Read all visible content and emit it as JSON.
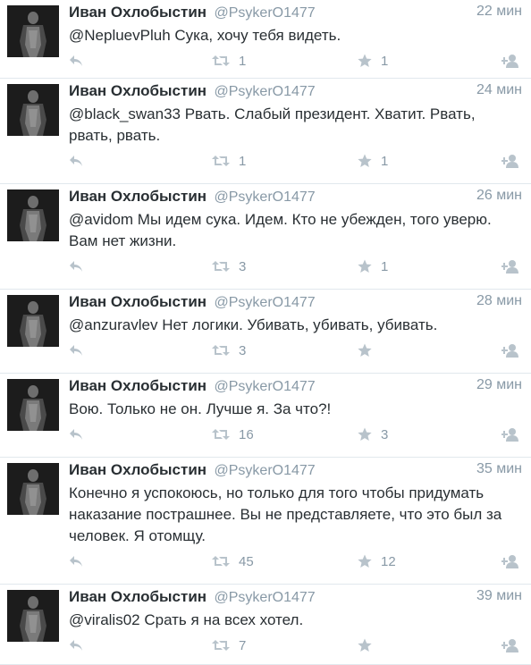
{
  "tweets": [
    {
      "name": "Иван Охлобыстин",
      "handle": "@PsykerO1477",
      "time": "22 мин",
      "text": "@NepluevPluh Сука, хочу тебя видеть.",
      "retweets": "1",
      "favorites": "1"
    },
    {
      "name": "Иван Охлобыстин",
      "handle": "@PsykerO1477",
      "time": "24 мин",
      "text": "@black_swan33 Рвать. Слабый президент. Хватит. Рвать, рвать, рвать.",
      "retweets": "1",
      "favorites": "1"
    },
    {
      "name": "Иван Охлобыстин",
      "handle": "@PsykerO1477",
      "time": "26 мин",
      "text": "@avidom Мы идем сука. Идем. Кто не убежден, того уверю. Вам нет жизни.",
      "retweets": "3",
      "favorites": "1"
    },
    {
      "name": "Иван Охлобыстин",
      "handle": "@PsykerO1477",
      "time": "28 мин",
      "text": "@anzuravlev Нет логики. Убивать, убивать, убивать.",
      "retweets": "3",
      "favorites": ""
    },
    {
      "name": "Иван Охлобыстин",
      "handle": "@PsykerO1477",
      "time": "29 мин",
      "text": "Вою. Только не он. Лучше я. За что?!",
      "retweets": "16",
      "favorites": "3"
    },
    {
      "name": "Иван Охлобыстин",
      "handle": "@PsykerO1477",
      "time": "35 мин",
      "text": "Конечно я успокоюсь, но только для того чтобы придумать наказание пострашнее. Вы не представляете, что это был за человек. Я отомщу.",
      "retweets": "45",
      "favorites": "12"
    },
    {
      "name": "Иван Охлобыстин",
      "handle": "@PsykerO1477",
      "time": "39 мин",
      "text": "@viralis02 Срать я на всех хотел.",
      "retweets": "7",
      "favorites": ""
    }
  ],
  "icons": {
    "reply": "reply-icon",
    "retweet": "retweet-icon",
    "favorite": "star-icon",
    "follow": "follow-icon",
    "color": "#b8c3cb"
  }
}
